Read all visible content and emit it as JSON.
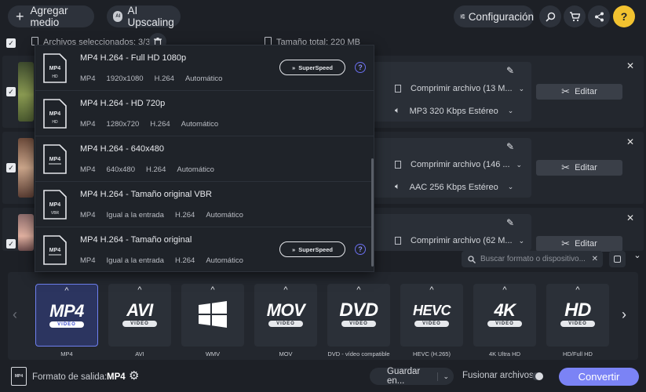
{
  "toolbar": {
    "add_media": "Agregar medio",
    "ai_upscaling": "AI Upscaling",
    "settings": "Configuración"
  },
  "files_bar": {
    "selected": "Archivos seleccionados: 3/3",
    "total_size": "Tamaño total: 220 MB"
  },
  "files": [
    {
      "compress": "Comprimir archivo (13 M...",
      "audio": "MP3 320 Kbps Estéreo",
      "edit": "Editar"
    },
    {
      "compress": "Comprimir archivo (146 ...",
      "audio": "AAC 256 Kbps Estéreo",
      "edit": "Editar"
    },
    {
      "compress": "Comprimir archivo (62 M...",
      "audio": "",
      "edit": "Editar"
    }
  ],
  "dropdown": {
    "items": [
      {
        "title": "MP4 H.264 - Full HD 1080p",
        "container": "MP4",
        "resolution": "1920x1080",
        "codec": "H.264",
        "mode": "Automático",
        "badge": "HD",
        "superspeed": "SuperSpeed"
      },
      {
        "title": "MP4 H.264 - HD 720p",
        "container": "MP4",
        "resolution": "1280x720",
        "codec": "H.264",
        "mode": "Automático",
        "badge": "HD"
      },
      {
        "title": "MP4 H.264 - 640x480",
        "container": "MP4",
        "resolution": "640x480",
        "codec": "H.264",
        "mode": "Automático",
        "badge": ""
      },
      {
        "title": "MP4 H.264 - Tamaño original VBR",
        "container": "MP4",
        "resolution": "Igual a la entrada",
        "codec": "H.264",
        "mode": "Automático",
        "badge": "VBR"
      },
      {
        "title": "MP4 H.264 - Tamaño original",
        "container": "MP4",
        "resolution": "Igual a la entrada",
        "codec": "H.264",
        "mode": "Automático",
        "badge": "",
        "superspeed": "SuperSpeed"
      }
    ]
  },
  "search": {
    "placeholder": "Buscar formato o dispositivo..."
  },
  "formats": [
    {
      "logo": "MP4",
      "label": "MP4",
      "selected": true
    },
    {
      "logo": "AVI",
      "label": "AVI"
    },
    {
      "logo": "",
      "label": "WMV"
    },
    {
      "logo": "MOV",
      "label": "MOV"
    },
    {
      "logo": "DVD",
      "label": "DVD - vídeo compatible"
    },
    {
      "logo": "HEVC",
      "label": "HEVC (H.265)"
    },
    {
      "logo": "4K",
      "label": "4K Ultra HD"
    },
    {
      "logo": "HD",
      "label": "HD/Full HD"
    }
  ],
  "video_tag": "VIDEO",
  "bottom": {
    "output_label": "Formato de salida:",
    "output_value": "MP4",
    "save_to": "Guardar en...",
    "merge": "Fusionar archivos:",
    "convert": "Convertir"
  },
  "colors": {
    "accent": "#7b83f5",
    "selected_card": "#2c3560",
    "background": "#1d2026"
  }
}
